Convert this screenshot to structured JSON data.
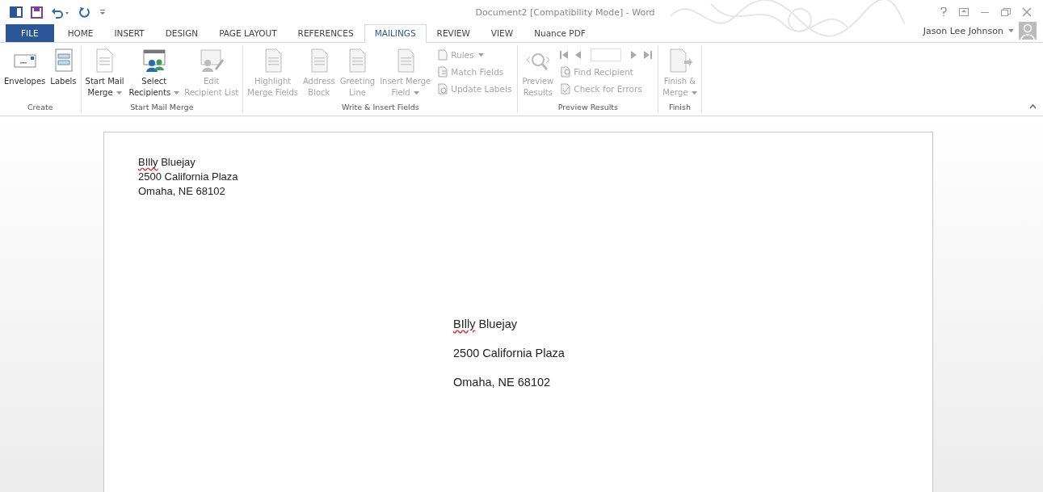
{
  "window": {
    "title": "Document2 [Compatibility Mode] - Word",
    "user": "Jason Lee Johnson"
  },
  "tabs": [
    {
      "label": "FILE",
      "kind": "file",
      "selected": false
    },
    {
      "label": "HOME",
      "kind": "tab",
      "selected": false
    },
    {
      "label": "INSERT",
      "kind": "tab",
      "selected": false
    },
    {
      "label": "DESIGN",
      "kind": "tab",
      "selected": false
    },
    {
      "label": "PAGE LAYOUT",
      "kind": "tab",
      "selected": false
    },
    {
      "label": "REFERENCES",
      "kind": "tab",
      "selected": false
    },
    {
      "label": "MAILINGS",
      "kind": "tab",
      "selected": true
    },
    {
      "label": "REVIEW",
      "kind": "tab",
      "selected": false
    },
    {
      "label": "VIEW",
      "kind": "tab",
      "selected": false
    },
    {
      "label": "Nuance PDF",
      "kind": "tab",
      "selected": false
    }
  ],
  "ribbon": [
    {
      "label": "Create",
      "items": [
        {
          "kind": "large",
          "lines": [
            "Envelopes"
          ],
          "menu": false,
          "disabled": false
        },
        {
          "kind": "large",
          "lines": [
            "Labels"
          ],
          "menu": false,
          "disabled": false
        }
      ]
    },
    {
      "label": "Start Mail Merge",
      "items": [
        {
          "kind": "large",
          "lines": [
            "Start Mail",
            "Merge"
          ],
          "menu": true,
          "disabled": false
        },
        {
          "kind": "large",
          "lines": [
            "Select",
            "Recipients"
          ],
          "menu": true,
          "disabled": false
        },
        {
          "kind": "large",
          "lines": [
            "Edit",
            "Recipient List"
          ],
          "menu": false,
          "disabled": true
        }
      ]
    },
    {
      "label": "Write & Insert Fields",
      "items": [
        {
          "kind": "large",
          "lines": [
            "Highlight",
            "Merge Fields"
          ],
          "menu": false,
          "disabled": true
        },
        {
          "kind": "large",
          "lines": [
            "Address",
            "Block"
          ],
          "menu": false,
          "disabled": true
        },
        {
          "kind": "large",
          "lines": [
            "Greeting",
            "Line"
          ],
          "menu": false,
          "disabled": true
        },
        {
          "kind": "large",
          "lines": [
            "Insert Merge",
            "Field"
          ],
          "menu": true,
          "disabled": true
        },
        {
          "kind": "stack",
          "buttons": [
            {
              "label": "Rules",
              "menu": true,
              "disabled": true
            },
            {
              "label": "Match Fields",
              "menu": false,
              "disabled": true
            },
            {
              "label": "Update Labels",
              "menu": false,
              "disabled": true
            }
          ]
        }
      ]
    },
    {
      "label": "Preview Results",
      "items": [
        {
          "kind": "large",
          "lines": [
            "Preview",
            "Results"
          ],
          "menu": false,
          "disabled": true
        },
        {
          "kind": "nav",
          "disabled": true,
          "buttons": [
            {
              "label": "Find Recipient",
              "disabled": true
            },
            {
              "label": "Check for Errors",
              "disabled": true
            }
          ]
        }
      ]
    },
    {
      "label": "Finish",
      "items": [
        {
          "kind": "large",
          "lines": [
            "Finish &",
            "Merge"
          ],
          "menu": true,
          "disabled": true
        }
      ]
    }
  ],
  "document": {
    "return_address": [
      {
        "words": [
          {
            "text": "BIlly",
            "misspelled": true
          },
          {
            "text": "Bluejay",
            "misspelled": false
          }
        ]
      },
      {
        "words": [
          {
            "text": "2500 California Plaza",
            "misspelled": false
          }
        ]
      },
      {
        "words": [
          {
            "text": "Omaha, NE 68102",
            "misspelled": false
          }
        ]
      }
    ],
    "delivery_address": [
      {
        "words": [
          {
            "text": "BIlly",
            "misspelled": true
          },
          {
            "text": "Bluejay",
            "misspelled": false
          }
        ]
      },
      {
        "words": [
          {
            "text": "2500 California Plaza",
            "misspelled": false
          }
        ]
      },
      {
        "words": [
          {
            "text": "Omaha, NE 68102",
            "misspelled": false
          }
        ]
      }
    ]
  }
}
